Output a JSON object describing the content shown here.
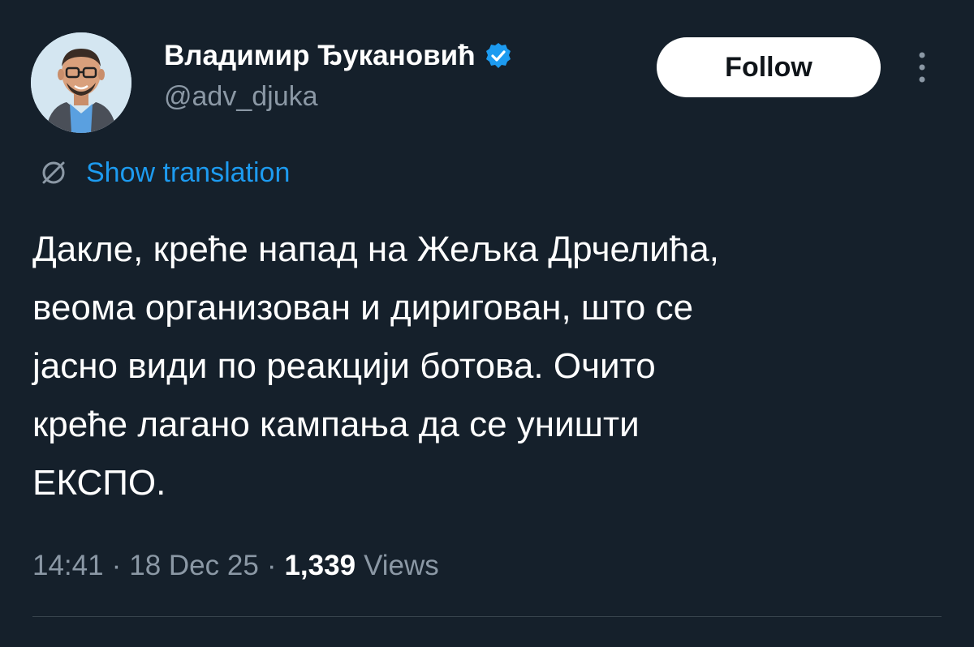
{
  "author": {
    "display_name": "Владимир Ђукановић",
    "handle": "@adv_djuka",
    "verified": true,
    "avatar_icon": "cartoon-avatar-icon"
  },
  "header": {
    "follow_label": "Follow",
    "more_icon": "more-vertical-icon"
  },
  "translation": {
    "icon": "globe-icon",
    "label": "Show translation"
  },
  "tweet": {
    "text": "Дакле, креће напад на Жељка Дрчелића,\nвеома организован и диригован, што се\nјасно види по реакцији ботова. Очито\nкреће лагано кампања да се уништи\nЕКСПО."
  },
  "meta": {
    "time": "14:41",
    "separator": "·",
    "date": "18 Dec 25",
    "views_count": "1,339",
    "views_label": "Views"
  },
  "colors": {
    "background": "#15202b",
    "primary_text": "#ffffff",
    "secondary_text": "#8b98a5",
    "link": "#1d9bf0",
    "verified": "#1d9bf0",
    "follow_bg": "#ffffff",
    "divider": "#38444d"
  }
}
